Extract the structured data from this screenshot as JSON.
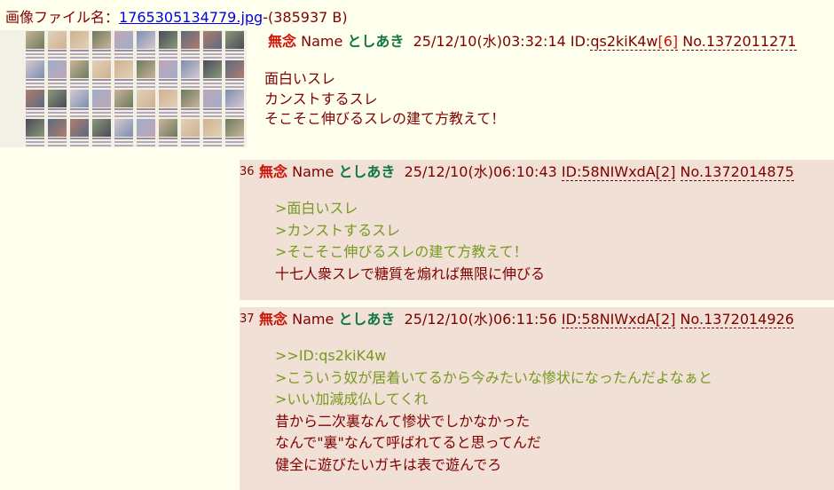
{
  "file": {
    "label": "画像ファイル名：",
    "name": "1765305134779.jpg",
    "size": "-(385937 B)"
  },
  "op": {
    "subject": "無念",
    "name_label": "Name",
    "name": "としあき",
    "date": "25/12/10(水)03:32:14",
    "id_prefix": "ID:",
    "id": "qs2kiK4w",
    "id_count": "[6]",
    "no": "No.1372011271",
    "lines": [
      "面白いスレ",
      "カンストするスレ",
      "そこそこ伸びるスレの建て方教えて！"
    ]
  },
  "replies": [
    {
      "num": "36",
      "subject": "無念",
      "name_label": "Name",
      "name": "としあき",
      "date": "25/12/10(水)06:10:43",
      "id": "ID:58NIWxdA[2]",
      "no": "No.1372014875",
      "lines": [
        ">面白いスレ",
        ">カンストするスレ",
        ">そこそこ伸びるスレの建て方教えて！",
        "十七人衆スレで糖質を煽れば無限に伸びる"
      ]
    },
    {
      "num": "37",
      "subject": "無念",
      "name_label": "Name",
      "name": "としあき",
      "date": "25/12/10(水)06:11:56",
      "id": "ID:58NIWxdA[2]",
      "no": "No.1372014926",
      "lines": [
        ">>ID:qs2kiK4w",
        ">こういう奴が居着いてるから今みたいな惨状になったんだよなぁと",
        ">いい加減成仏してくれ",
        "昔から二次裏なんて惨状でしかなかった",
        "なんで\"裏\"なんて呼ばれてると思ってんだ",
        "健全に遊びたいガキは表で遊んでろ"
      ]
    }
  ],
  "colors": {
    "background": "#ffffee",
    "reply_background": "#f0e0d6",
    "text": "#800000",
    "subject": "#cc1105",
    "name": "#117743",
    "quote": "#789922",
    "link": "#0000ee"
  }
}
